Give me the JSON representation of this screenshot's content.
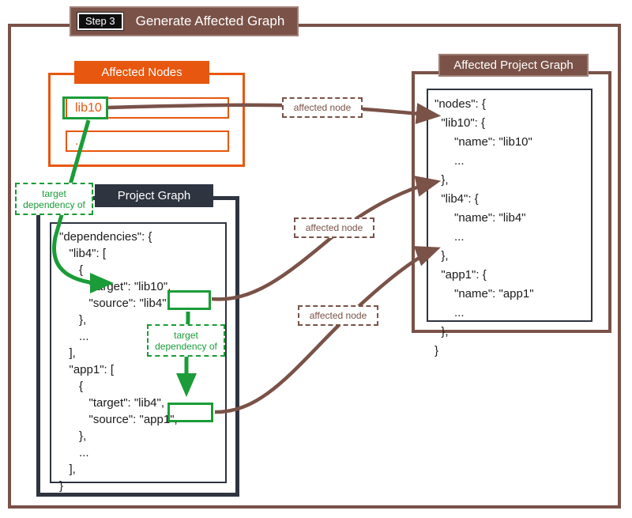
{
  "step": {
    "badge": "Step 3",
    "title": "Generate Affected Graph"
  },
  "colors": {
    "frame_brown": "#7a5248",
    "accent_orange": "#e8570f",
    "accent_green": "#1a9c38",
    "panel_dark": "#2e3440",
    "background": "#ffffff"
  },
  "affected_nodes": {
    "header": "Affected Nodes",
    "rows": [
      {
        "label": "lib10",
        "highlighted": true
      },
      {
        "label": "..",
        "highlighted": false
      }
    ]
  },
  "project_graph": {
    "header": "Project Graph",
    "code": "\"dependencies\": {\n   \"lib4\": [\n      {\n         \"target\": \"lib10\",\n         \"source\": \"lib4\",\n      },\n      ...\n   ],\n   \"app1\": [\n      {\n         \"target\": \"lib4\",\n         \"source\": \"app1\",\n      },\n      ...\n   ],\n}",
    "highlights": [
      "\"lib4\",",
      "\"app1\","
    ]
  },
  "affected_project_graph": {
    "header": "Affected Project Graph",
    "code": "\"nodes\": {\n  \"lib10\": {\n      \"name\": \"lib10\"\n      ...\n  },\n  \"lib4\": {\n      \"name\": \"lib4\"\n      ...\n  },\n  \"app1\": {\n      \"name\": \"app1\"\n      ...\n  },\n}"
  },
  "annotations": {
    "affected_node_1": "affected node",
    "affected_node_2": "affected node",
    "affected_node_3": "affected node",
    "target_dependency_of_1": "target\ndependency of",
    "target_dependency_of_2": "target\ndependency of"
  }
}
